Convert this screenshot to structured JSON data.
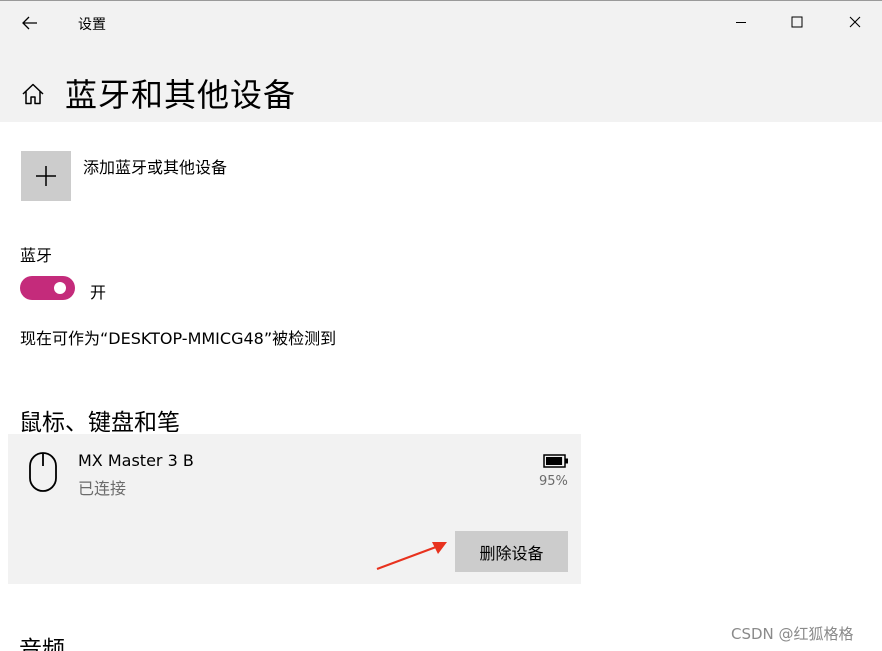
{
  "window": {
    "title": "设置",
    "icons": {
      "back": "back-arrow-icon",
      "minimize": "minimize-icon",
      "maximize": "maximize-icon",
      "close": "close-icon"
    }
  },
  "header": {
    "title": "蓝牙和其他设备",
    "icon": "home-icon"
  },
  "add_device": {
    "label": "添加蓝牙或其他设备",
    "icon": "plus-icon"
  },
  "bluetooth": {
    "label": "蓝牙",
    "toggle_state": "开",
    "toggle_on": true,
    "discoverable_text": "现在可作为“DESKTOP-MMICG48”被检测到",
    "accent_color": "#c42b7b"
  },
  "mouse_section": {
    "title": "鼠标、键盘和笔",
    "device": {
      "name": "MX Master 3 B",
      "status": "已连接",
      "battery": "95%",
      "battery_level": 0.95,
      "icon": "mouse-icon",
      "remove_label": "删除设备"
    }
  },
  "audio_section": {
    "title": "音频"
  },
  "watermark": "CSDN @红狐格格"
}
